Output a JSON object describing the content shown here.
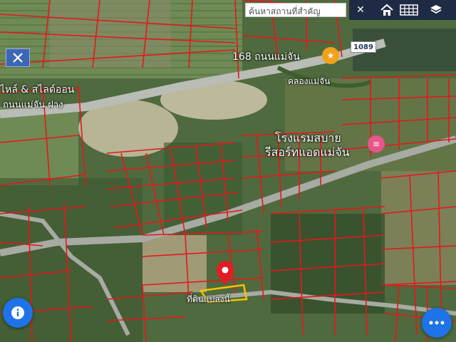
{
  "search": {
    "placeholder": "ค้นหาสถานที่สำคัญ"
  },
  "toolbar": {
    "close_icon": "close-icon",
    "home_icon": "home-icon",
    "table_icon": "table-icon",
    "layers_icon": "layers-icon",
    "background_color": "#1f2b44"
  },
  "map": {
    "labels": {
      "road_168": "168 ถนนแม่จัน",
      "shop": "ไหล์ & สไลด์ออน",
      "road_mae_chan": "ถนนแม่จัน ฝาง",
      "canal": "คลองแม่จัน",
      "hotel_line1": "โรงแรมสบาย",
      "hotel_line2": "รีสอร์ทแอดแม่จัน",
      "plot": "ที่ดินแปลงนี้"
    },
    "road_badge": "1089",
    "parcel_line_color": "#e8161b",
    "plot_outline_color": "#f5c400",
    "marker_color": "#e31b23"
  },
  "controls": {
    "tool_icon": "crossed-tools-icon",
    "info_icon": "info-icon",
    "more_icon": "more-dots-icon",
    "fab_color": "#1e73e8"
  }
}
